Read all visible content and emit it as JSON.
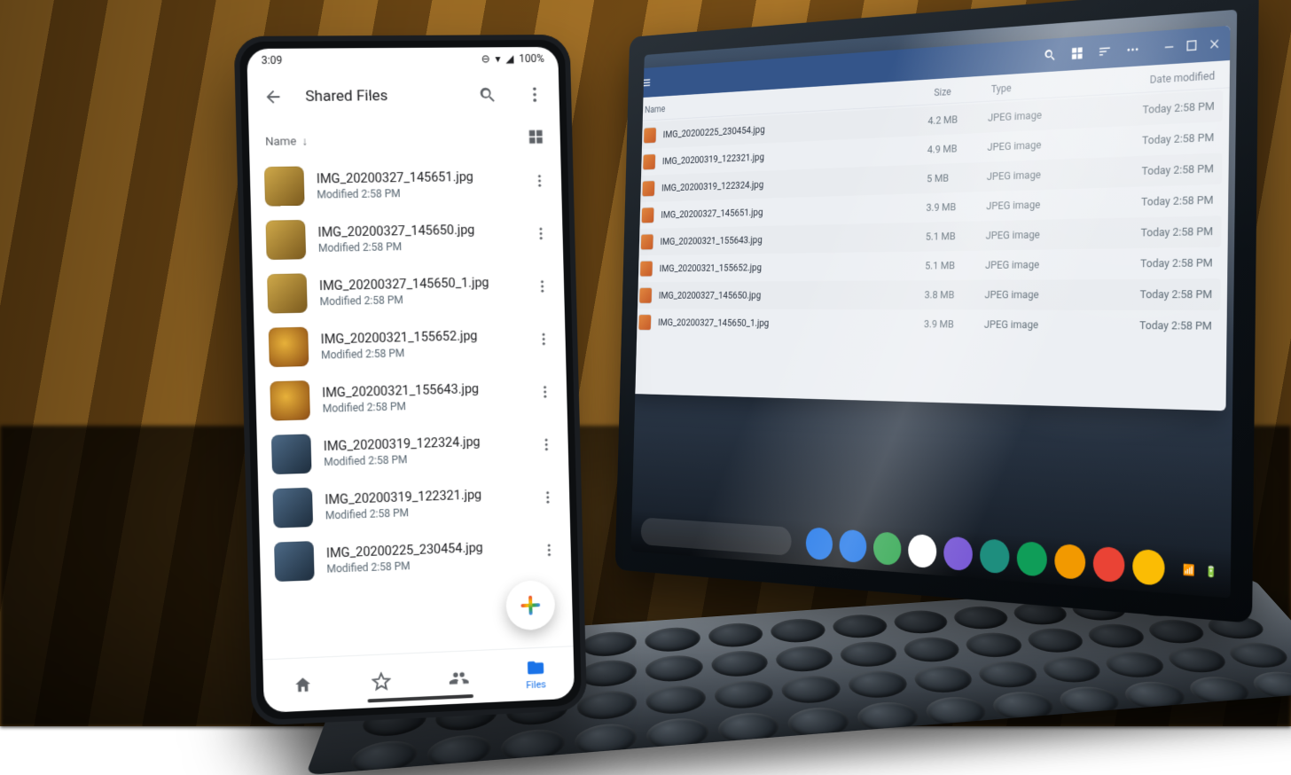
{
  "phone": {
    "status": {
      "time": "3:09",
      "battery": "100%"
    },
    "appbar": {
      "title": "Shared Files"
    },
    "sort": {
      "label": "Name"
    },
    "files": [
      {
        "name": "IMG_20200327_145651.jpg",
        "sub": "Modified 2:58 PM",
        "thumb": ""
      },
      {
        "name": "IMG_20200327_145650.jpg",
        "sub": "Modified 2:58 PM",
        "thumb": ""
      },
      {
        "name": "IMG_20200327_145650_1.jpg",
        "sub": "Modified 2:58 PM",
        "thumb": ""
      },
      {
        "name": "IMG_20200321_155652.jpg",
        "sub": "Modified 2:58 PM",
        "thumb": "food"
      },
      {
        "name": "IMG_20200321_155643.jpg",
        "sub": "Modified 2:58 PM",
        "thumb": "food"
      },
      {
        "name": "IMG_20200319_122324.jpg",
        "sub": "Modified 2:58 PM",
        "thumb": "tech"
      },
      {
        "name": "IMG_20200319_122321.jpg",
        "sub": "Modified 2:58 PM",
        "thumb": "tech"
      },
      {
        "name": "IMG_20200225_230454.jpg",
        "sub": "Modified 2:58 PM",
        "thumb": "tech"
      }
    ],
    "nav": {
      "files": "Files"
    }
  },
  "laptop": {
    "columns": {
      "name": "Name",
      "size": "Size",
      "type": "Type",
      "date": "Date modified"
    },
    "rows": [
      {
        "name": "IMG_20200225_230454.jpg",
        "size": "4.2 MB",
        "type": "JPEG image",
        "date": "Today 2:58 PM"
      },
      {
        "name": "IMG_20200319_122321.jpg",
        "size": "4.9 MB",
        "type": "JPEG image",
        "date": "Today 2:58 PM"
      },
      {
        "name": "IMG_20200319_122324.jpg",
        "size": "5 MB",
        "type": "JPEG image",
        "date": "Today 2:58 PM"
      },
      {
        "name": "IMG_20200327_145651.jpg",
        "size": "3.9 MB",
        "type": "JPEG image",
        "date": "Today 2:58 PM"
      },
      {
        "name": "IMG_20200321_155643.jpg",
        "size": "5.1 MB",
        "type": "JPEG image",
        "date": "Today 2:58 PM"
      },
      {
        "name": "IMG_20200321_155652.jpg",
        "size": "5.1 MB",
        "type": "JPEG image",
        "date": "Today 2:58 PM"
      },
      {
        "name": "IMG_20200327_145650.jpg",
        "size": "3.8 MB",
        "type": "JPEG image",
        "date": "Today 2:58 PM"
      },
      {
        "name": "IMG_20200327_145650_1.jpg",
        "size": "3.9 MB",
        "type": "JPEG image",
        "date": "Today 2:58 PM"
      }
    ]
  }
}
